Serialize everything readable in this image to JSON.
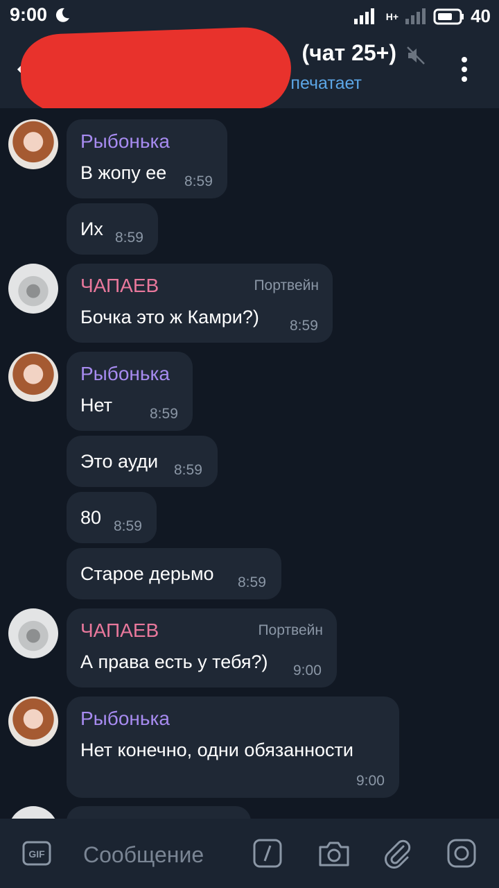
{
  "status_bar": {
    "time": "9:00",
    "network": "H+",
    "battery": "40",
    "icons": [
      "moon-icon",
      "signal-icon",
      "battery-icon"
    ]
  },
  "header": {
    "title": "(чат 25+)",
    "status": "печатает",
    "icons": [
      "back-arrow-icon",
      "mute-icon",
      "more-vertical-icon"
    ]
  },
  "messages": [
    {
      "sender": "Рыбонька",
      "text": "В жопу ее",
      "time": "8:59"
    },
    {
      "text": "Их",
      "time": "8:59"
    },
    {
      "sender": "ЧАПАЕВ",
      "admin_title": "Портвейн",
      "text": "Бочка это ж Камри?)",
      "time": "8:59"
    },
    {
      "sender": "Рыбонька",
      "text": "Нет",
      "time": "8:59"
    },
    {
      "text": "Это ауди",
      "time": "8:59"
    },
    {
      "text": "80",
      "time": "8:59"
    },
    {
      "text": "Старое дерьмо",
      "time": "8:59"
    },
    {
      "sender": "ЧАПАЕВ",
      "admin_title": "Портвейн",
      "text": "А права есть у тебя?)",
      "time": "9:00"
    },
    {
      "sender": "Рыбонька",
      "text": "Нет конечно, одни обязанности",
      "time": "9:00"
    }
  ],
  "input_bar": {
    "placeholder": "Сообщение",
    "gif_label": "GIF",
    "icons": [
      "gif-icon",
      "slash-command-icon",
      "camera-icon",
      "attach-icon",
      "instagram-icon"
    ]
  },
  "colors": {
    "background": "#111823",
    "bar": "#1b2431",
    "bubble": "#1f2835",
    "name_fish": "#a78bf0",
    "name_chapaev": "#e9789c",
    "status_blue": "#5ca6e6",
    "redaction": "#e8322c"
  }
}
